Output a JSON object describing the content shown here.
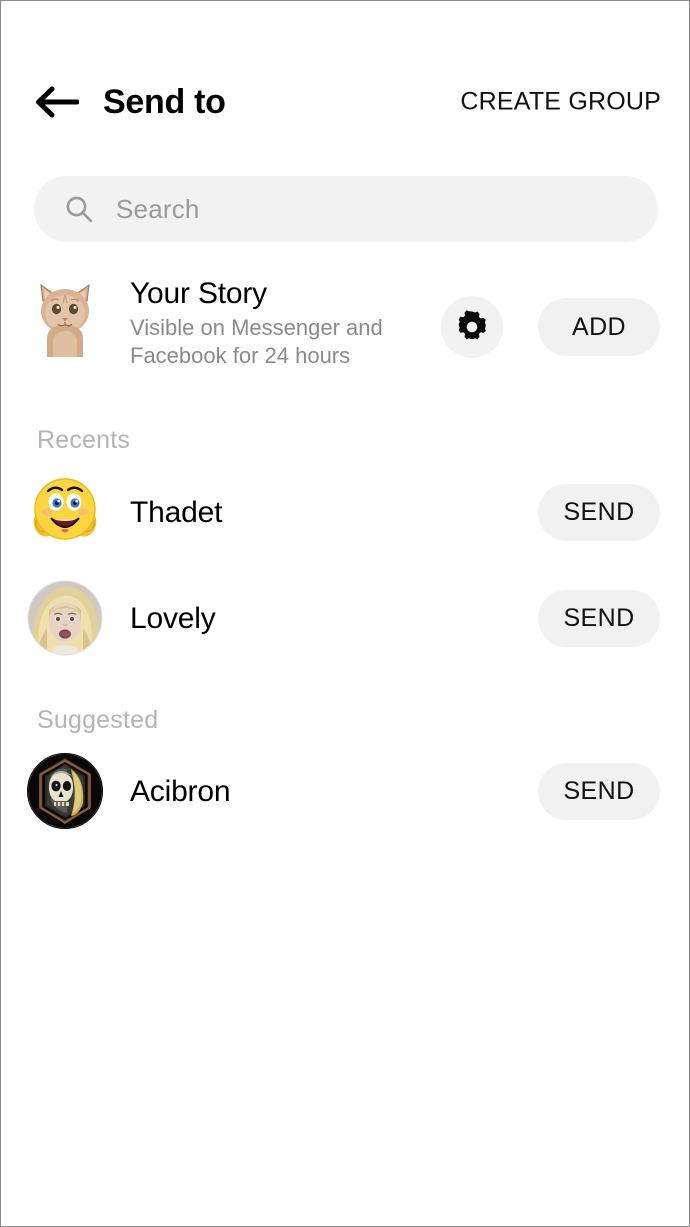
{
  "header": {
    "back_icon": "arrow-left-icon",
    "title": "Send to",
    "create_group_label": "CREATE GROUP"
  },
  "search": {
    "icon": "search-icon",
    "placeholder": "Search",
    "value": ""
  },
  "story": {
    "avatar": "cat-photo-avatar",
    "title": "Your Story",
    "subtitle": "Visible on Messenger and Facebook for 24 hours",
    "settings_icon": "gear-icon",
    "add_label": "ADD"
  },
  "sections": [
    {
      "label": "Recents",
      "items": [
        {
          "name": "Thadet",
          "avatar": "smiley-emoji-avatar",
          "action_label": "SEND"
        },
        {
          "name": "Lovely",
          "avatar": "blonde-woman-photo-avatar",
          "action_label": "SEND"
        }
      ]
    },
    {
      "label": "Suggested",
      "items": [
        {
          "name": "Acibron",
          "avatar": "skull-reaper-avatar",
          "action_label": "SEND"
        }
      ]
    }
  ],
  "colors": {
    "background": "#ffffff",
    "chip_background": "#f1f1f1",
    "search_background": "#f2f2f2",
    "primary_text": "#000000",
    "secondary_text": "#8a8a8a",
    "section_text": "#b4b4b4"
  }
}
